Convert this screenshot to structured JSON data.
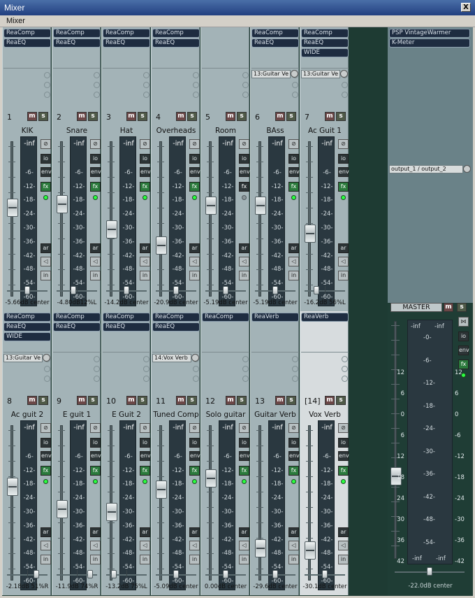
{
  "window": {
    "title": "Mixer",
    "close_label": "X",
    "menu_label": "Mixer"
  },
  "meter_scale": [
    "-inf",
    "-6-",
    "-12-",
    "-18-",
    "-24-",
    "-30-",
    "-36-",
    "-42-",
    "-48-",
    "-54-",
    "-60-"
  ],
  "labels": {
    "mute": "m",
    "solo": "s",
    "io": "io",
    "env": "env",
    "fx": "fx",
    "ar": "ar",
    "in": "in"
  },
  "tracks": [
    {
      "num": "1",
      "name": "KIK",
      "fx": [
        "ReaComp",
        "ReaEQ"
      ],
      "send": "",
      "footer": "-5.66dB center",
      "fader": 0.55,
      "pan": 0.5,
      "fx_on": true
    },
    {
      "num": "2",
      "name": "Snare",
      "fx": [
        "ReaComp",
        "ReaEQ"
      ],
      "send": "",
      "footer": "-4.80dB12%L",
      "fader": 0.57,
      "pan": 0.4,
      "fx_on": true
    },
    {
      "num": "3",
      "name": "Hat",
      "fx": [
        "ReaComp",
        "ReaEQ"
      ],
      "send": "",
      "footer": "-14.2dB center",
      "fader": 0.4,
      "pan": 0.5,
      "fx_on": true
    },
    {
      "num": "4",
      "name": "Overheads",
      "fx": [
        "ReaComp",
        "ReaEQ"
      ],
      "send": "",
      "footer": "-20.9dB center",
      "fader": 0.29,
      "pan": 0.5,
      "fx_on": true
    },
    {
      "num": "5",
      "name": "Room",
      "fx": [],
      "send": "",
      "footer": "-5.19dB center",
      "fader": 0.56,
      "pan": 0.5,
      "fx_on": false
    },
    {
      "num": "6",
      "name": "BAss",
      "fx": [
        "ReaComp",
        "ReaEQ"
      ],
      "send": "13:Guitar Ve",
      "footer": "-5.19dB center",
      "fader": 0.56,
      "pan": 0.5,
      "fx_on": true
    },
    {
      "num": "7",
      "name": "Ac Guit 1",
      "fx": [
        "ReaComp",
        "ReaEQ",
        "WIDE"
      ],
      "send": "13:Guitar Ve",
      "footer": "-16.2dB 56%L",
      "fader": 0.37,
      "pan": 0.25,
      "fx_on": true
    },
    {
      "num": "8",
      "name": "Ac guit 2",
      "fx": [
        "ReaComp",
        "ReaEQ",
        "WIDE"
      ],
      "send": "13:Guitar Ve",
      "footer": "-2.18dB 51%R",
      "fader": 0.58,
      "pan": 0.75,
      "fx_on": true
    },
    {
      "num": "9",
      "name": "E guit 1",
      "fx": [
        "ReaComp",
        "ReaEQ"
      ],
      "send": "",
      "footer": "-11.9dB 74%R",
      "fader": 0.43,
      "pan": 0.87,
      "fx_on": true
    },
    {
      "num": "10",
      "name": "E Guit 2",
      "fx": [
        "ReaComp",
        "ReaEQ"
      ],
      "send": "",
      "footer": "-13.2dB 75%L",
      "fader": 0.41,
      "pan": 0.13,
      "fx_on": true
    },
    {
      "num": "11",
      "name": "Tuned Comp",
      "fx": [
        "ReaComp",
        "ReaEQ"
      ],
      "send": "14:Vox Verb",
      "footer": "-5.09dB center",
      "fader": 0.56,
      "pan": 0.5,
      "fx_on": true
    },
    {
      "num": "12",
      "name": "Solo guitar",
      "fx": [
        "ReaComp"
      ],
      "send": "",
      "footer": "0.00dB center",
      "fader": 0.64,
      "pan": 0.5,
      "fx_on": true
    },
    {
      "num": "13",
      "name": "Guitar Verb",
      "fx": [
        "ReaVerb"
      ],
      "send": "",
      "footer": "-29.6dB center",
      "fader": 0.16,
      "pan": 0.5,
      "fx_on": true
    },
    {
      "num": "[14]",
      "name": "Vox Verb",
      "fx": [
        "ReaVerb"
      ],
      "send": "",
      "footer": "-30.1dB center",
      "fader": 0.15,
      "pan": 0.5,
      "fx_on": true
    }
  ],
  "master": {
    "fx": [
      "PSP VintageWarmer",
      "K-Meter"
    ],
    "send": "output_1 / output_2",
    "label": "MASTER",
    "footer": "-22.0dB center",
    "fader": 0.34,
    "pan": 0.5,
    "left_scale": [
      "12",
      "6",
      "0",
      "6",
      "12",
      "18",
      "24",
      "30",
      "36",
      "42"
    ],
    "mid_scale": [
      "-0-",
      "-6-",
      "-12-",
      "-18-",
      "-24-",
      "-30-",
      "-36-",
      "-42-",
      "-48-",
      "-54-"
    ],
    "right_scale": [
      "12",
      "6",
      "0",
      "-6",
      "-12",
      "-18",
      "-24",
      "-30",
      "-36",
      "-42"
    ],
    "peak": "-inf"
  },
  "colors": {
    "fx_active": "#2b7a3c",
    "meter_bg": "#2a3840",
    "strip": "#a3b3b7",
    "background": "#1e3b33"
  }
}
